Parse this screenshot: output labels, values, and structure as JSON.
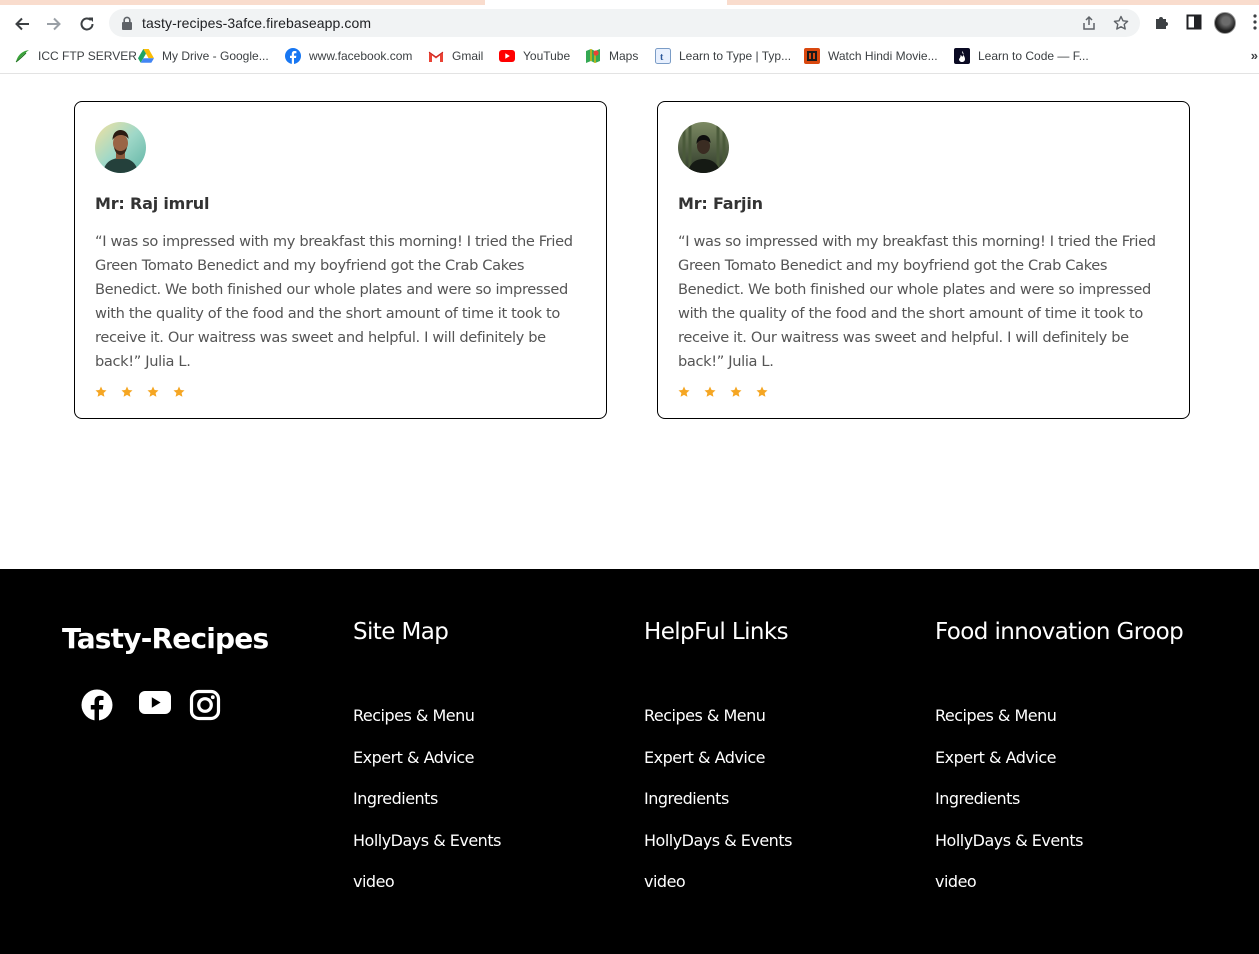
{
  "browser": {
    "url": "tasty-recipes-3afce.firebaseapp.com",
    "bookmarks": [
      {
        "label": "ICC FTP SERVER",
        "icon": "icc-leaf-icon"
      },
      {
        "label": "My Drive - Google...",
        "icon": "google-drive-icon"
      },
      {
        "label": "www.facebook.com",
        "icon": "facebook-icon"
      },
      {
        "label": "Gmail",
        "icon": "gmail-icon"
      },
      {
        "label": "YouTube",
        "icon": "youtube-icon"
      },
      {
        "label": "Maps",
        "icon": "maps-icon"
      },
      {
        "label": "Learn to Type | Typ...",
        "icon": "typing-icon"
      },
      {
        "label": "Watch Hindi Movie...",
        "icon": "movie-icon"
      },
      {
        "label": "Learn to Code — F...",
        "icon": "freecodecamp-icon"
      }
    ],
    "more": "»"
  },
  "reviews": [
    {
      "name": "Mr: Raj imrul",
      "quote": "“I was so impressed with my breakfast this morning! I tried the Fried Green Tomato Benedict and my boyfriend got the Crab Cakes Benedict. We both finished our whole plates and were so impressed with the quality of the food and the short amount of time it took to receive it. Our waitress was sweet and helpful. I will definitely be back!” Julia L.",
      "rating": 4
    },
    {
      "name": "Mr: Farjin",
      "quote": "“I was so impressed with my breakfast this morning! I tried the Fried Green Tomato Benedict and my boyfriend got the Crab Cakes Benedict. We both finished our whole plates and were so impressed with the quality of the food and the short amount of time it took to receive it. Our waitress was sweet and helpful. I will definitely be back!” Julia L.",
      "rating": 4
    }
  ],
  "colors": {
    "star": "#f5a623",
    "footer_bg": "#000000",
    "footer_text": "#ffffff"
  },
  "footer": {
    "brand": "Tasty-Recipes",
    "social": [
      "facebook-icon",
      "youtube-icon",
      "instagram-icon"
    ],
    "columns": [
      {
        "title": "Site Map",
        "links": [
          "Recipes & Menu",
          "Expert & Advice",
          "Ingredients",
          "HollyDays & Events",
          "video"
        ]
      },
      {
        "title": "HelpFul Links",
        "links": [
          "Recipes & Menu",
          "Expert & Advice",
          "Ingredients",
          "HollyDays & Events",
          "video"
        ]
      },
      {
        "title": "Food innovation Groop",
        "links": [
          "Recipes & Menu",
          "Expert & Advice",
          "Ingredients",
          "HollyDays & Events",
          "video"
        ]
      }
    ]
  }
}
